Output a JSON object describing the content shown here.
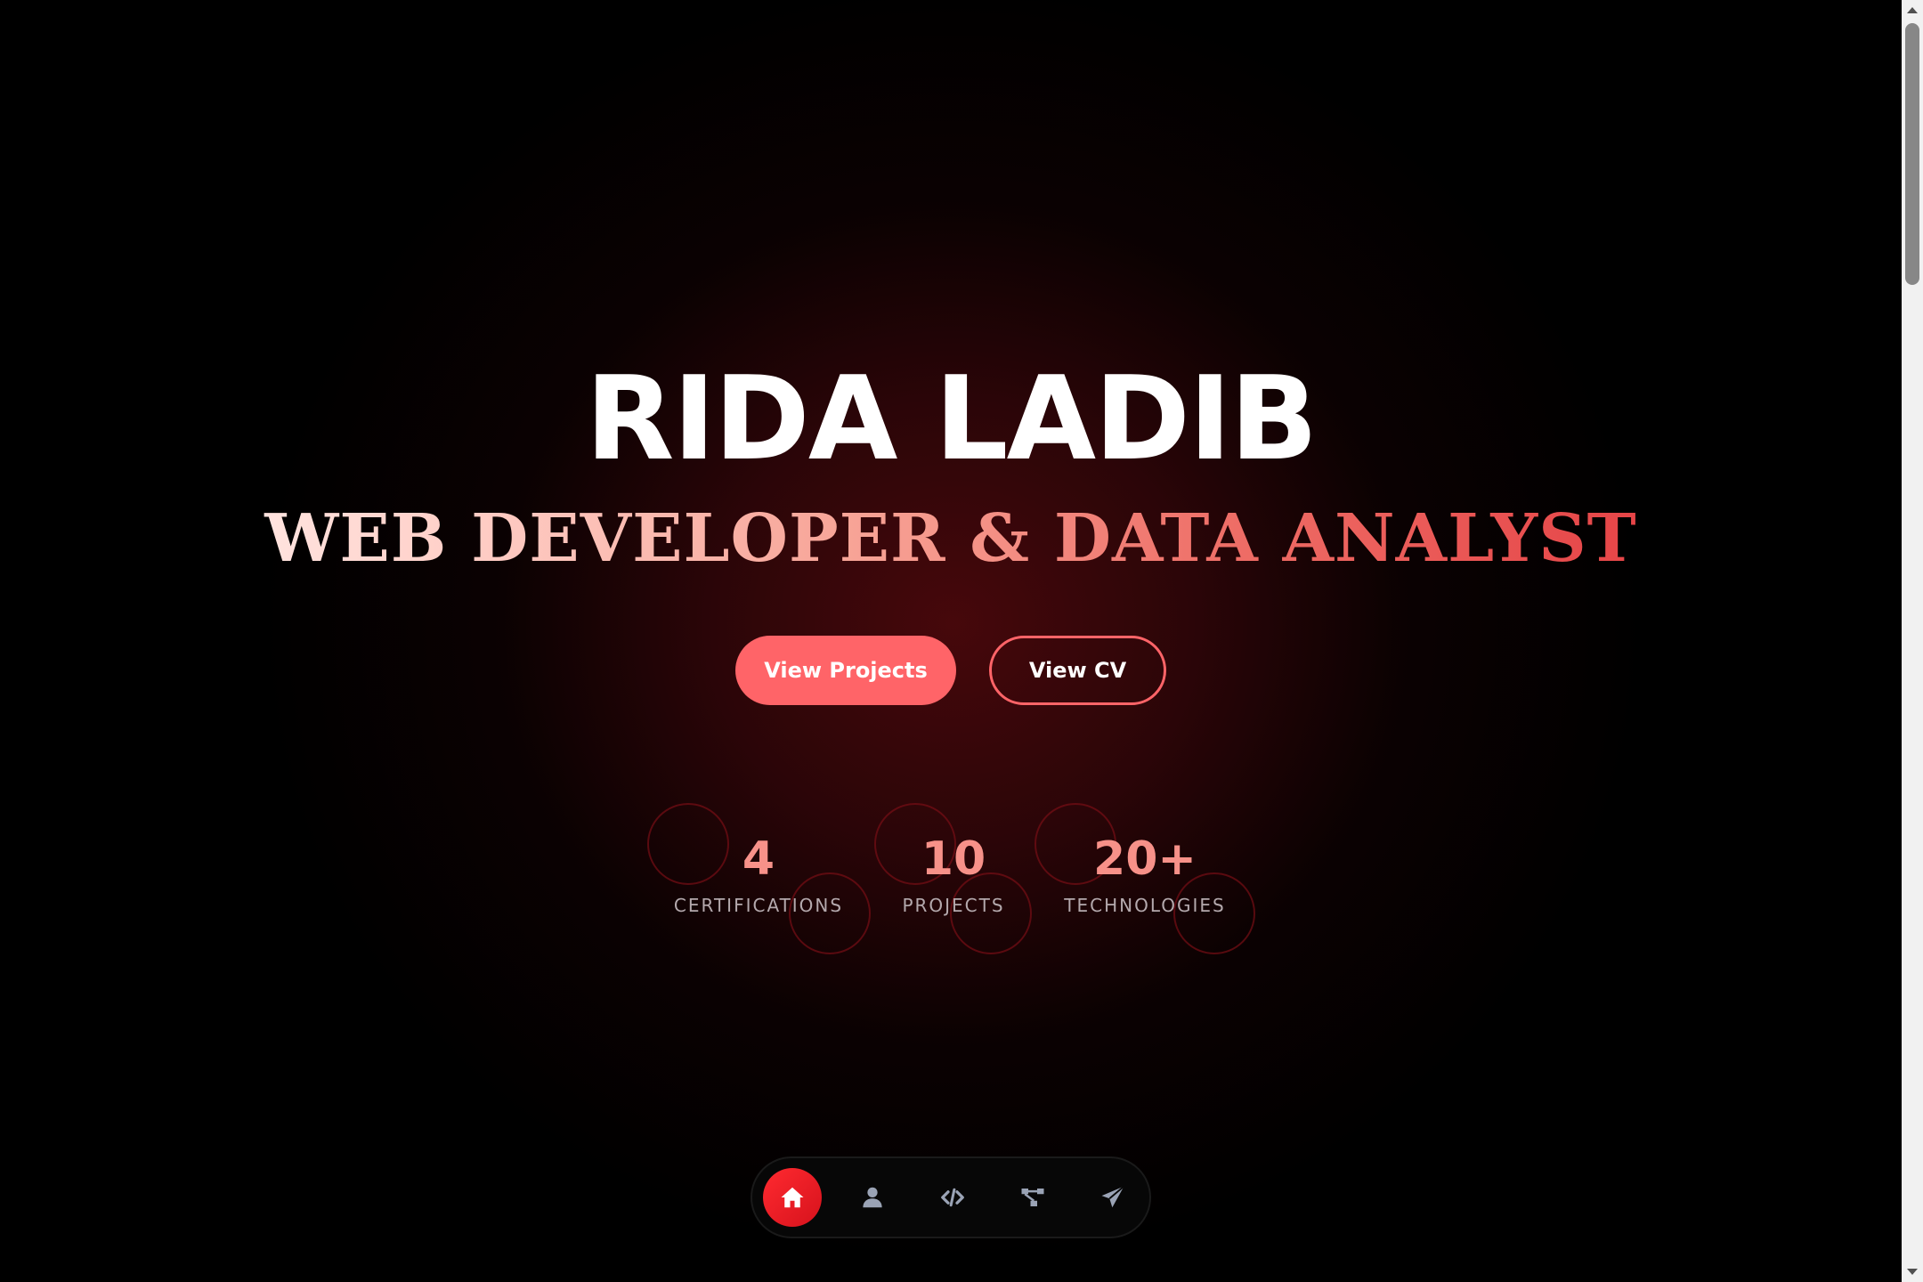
{
  "hero": {
    "name": "RIDA LADIB",
    "subtitle": "WEB DEVELOPER & DATA ANALYST"
  },
  "cta": {
    "primary_label": "View Projects",
    "secondary_label": "View CV"
  },
  "stats": [
    {
      "value": "4",
      "label": "Certifications"
    },
    {
      "value": "10",
      "label": "Projects"
    },
    {
      "value": "20+",
      "label": "Technologies"
    }
  ],
  "dock": {
    "items": [
      {
        "icon": "home-icon",
        "active": true
      },
      {
        "icon": "user-icon",
        "active": false
      },
      {
        "icon": "code-icon",
        "active": false
      },
      {
        "icon": "diagram-icon",
        "active": false
      },
      {
        "icon": "paper-plane-icon",
        "active": false
      }
    ]
  },
  "colors": {
    "accent": "#ff6468",
    "active_nav": "#ff2a30",
    "stat_value": "#f79189",
    "background": "#000000"
  }
}
